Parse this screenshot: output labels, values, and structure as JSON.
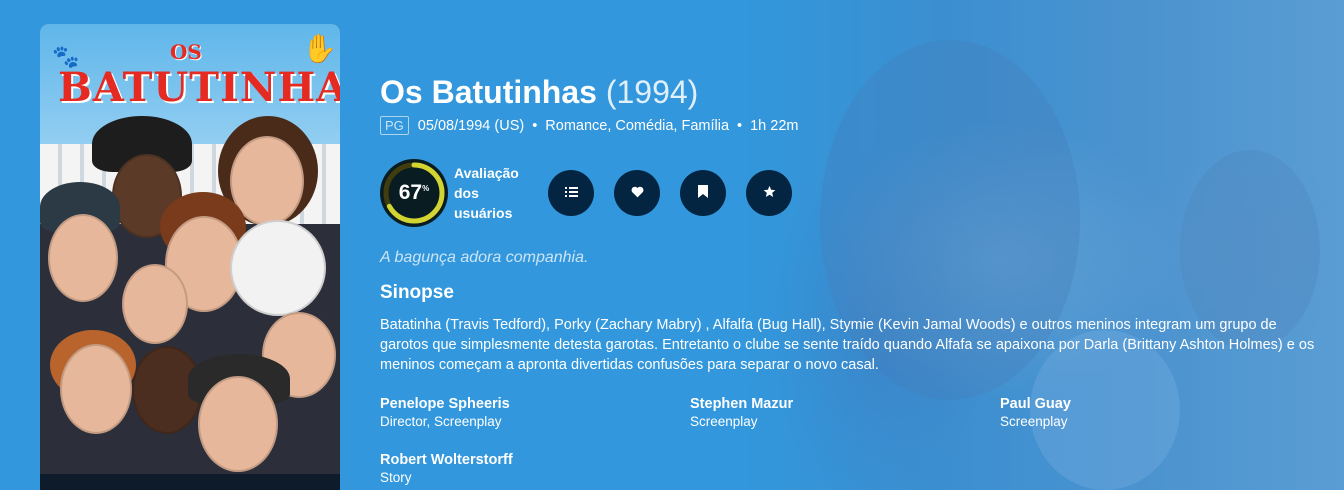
{
  "poster": {
    "title_small": "OS",
    "title_large": "BATUTINHAS"
  },
  "movie": {
    "title": "Os Batutinhas",
    "year": "(1994)",
    "certification": "PG",
    "release": "05/08/1994 (US)",
    "genres": "Romance, Comédia, Família",
    "runtime": "1h 22m",
    "separator": "•"
  },
  "score": {
    "value": "67",
    "unit": "%",
    "percent": 67,
    "label_line1": "Avaliação",
    "label_line2": "dos",
    "label_line3": "usuários",
    "ring_color": "#d2d531",
    "track_color": "#423d0f"
  },
  "actions": [
    {
      "name": "add-to-list",
      "icon": "list-icon"
    },
    {
      "name": "favorite",
      "icon": "heart-icon"
    },
    {
      "name": "watchlist",
      "icon": "bookmark-icon"
    },
    {
      "name": "rate",
      "icon": "star-icon"
    }
  ],
  "tagline": "A bagunça adora companhia.",
  "overview_heading": "Sinopse",
  "overview": "Batatinha (Travis Tedford), Porky (Zachary Mabry) , Alfalfa (Bug Hall), Stymie (Kevin Jamal Woods) e outros meninos integram um grupo de garotos que simplesmente detesta garotas. Entretanto o clube se sente traído quando Alfafa se apaixona por Darla (Brittany Ashton Holmes) e os meninos começam a apronta divertidas confusões para separar o novo casal.",
  "crew": [
    {
      "name": "Penelope Spheeris",
      "job": "Director, Screenplay"
    },
    {
      "name": "Stephen Mazur",
      "job": "Screenplay"
    },
    {
      "name": "Paul Guay",
      "job": "Screenplay"
    },
    {
      "name": "Robert Wolterstorff",
      "job": "Story"
    }
  ],
  "colors": {
    "background": "#2f8fd6",
    "button_bg": "#032541"
  }
}
